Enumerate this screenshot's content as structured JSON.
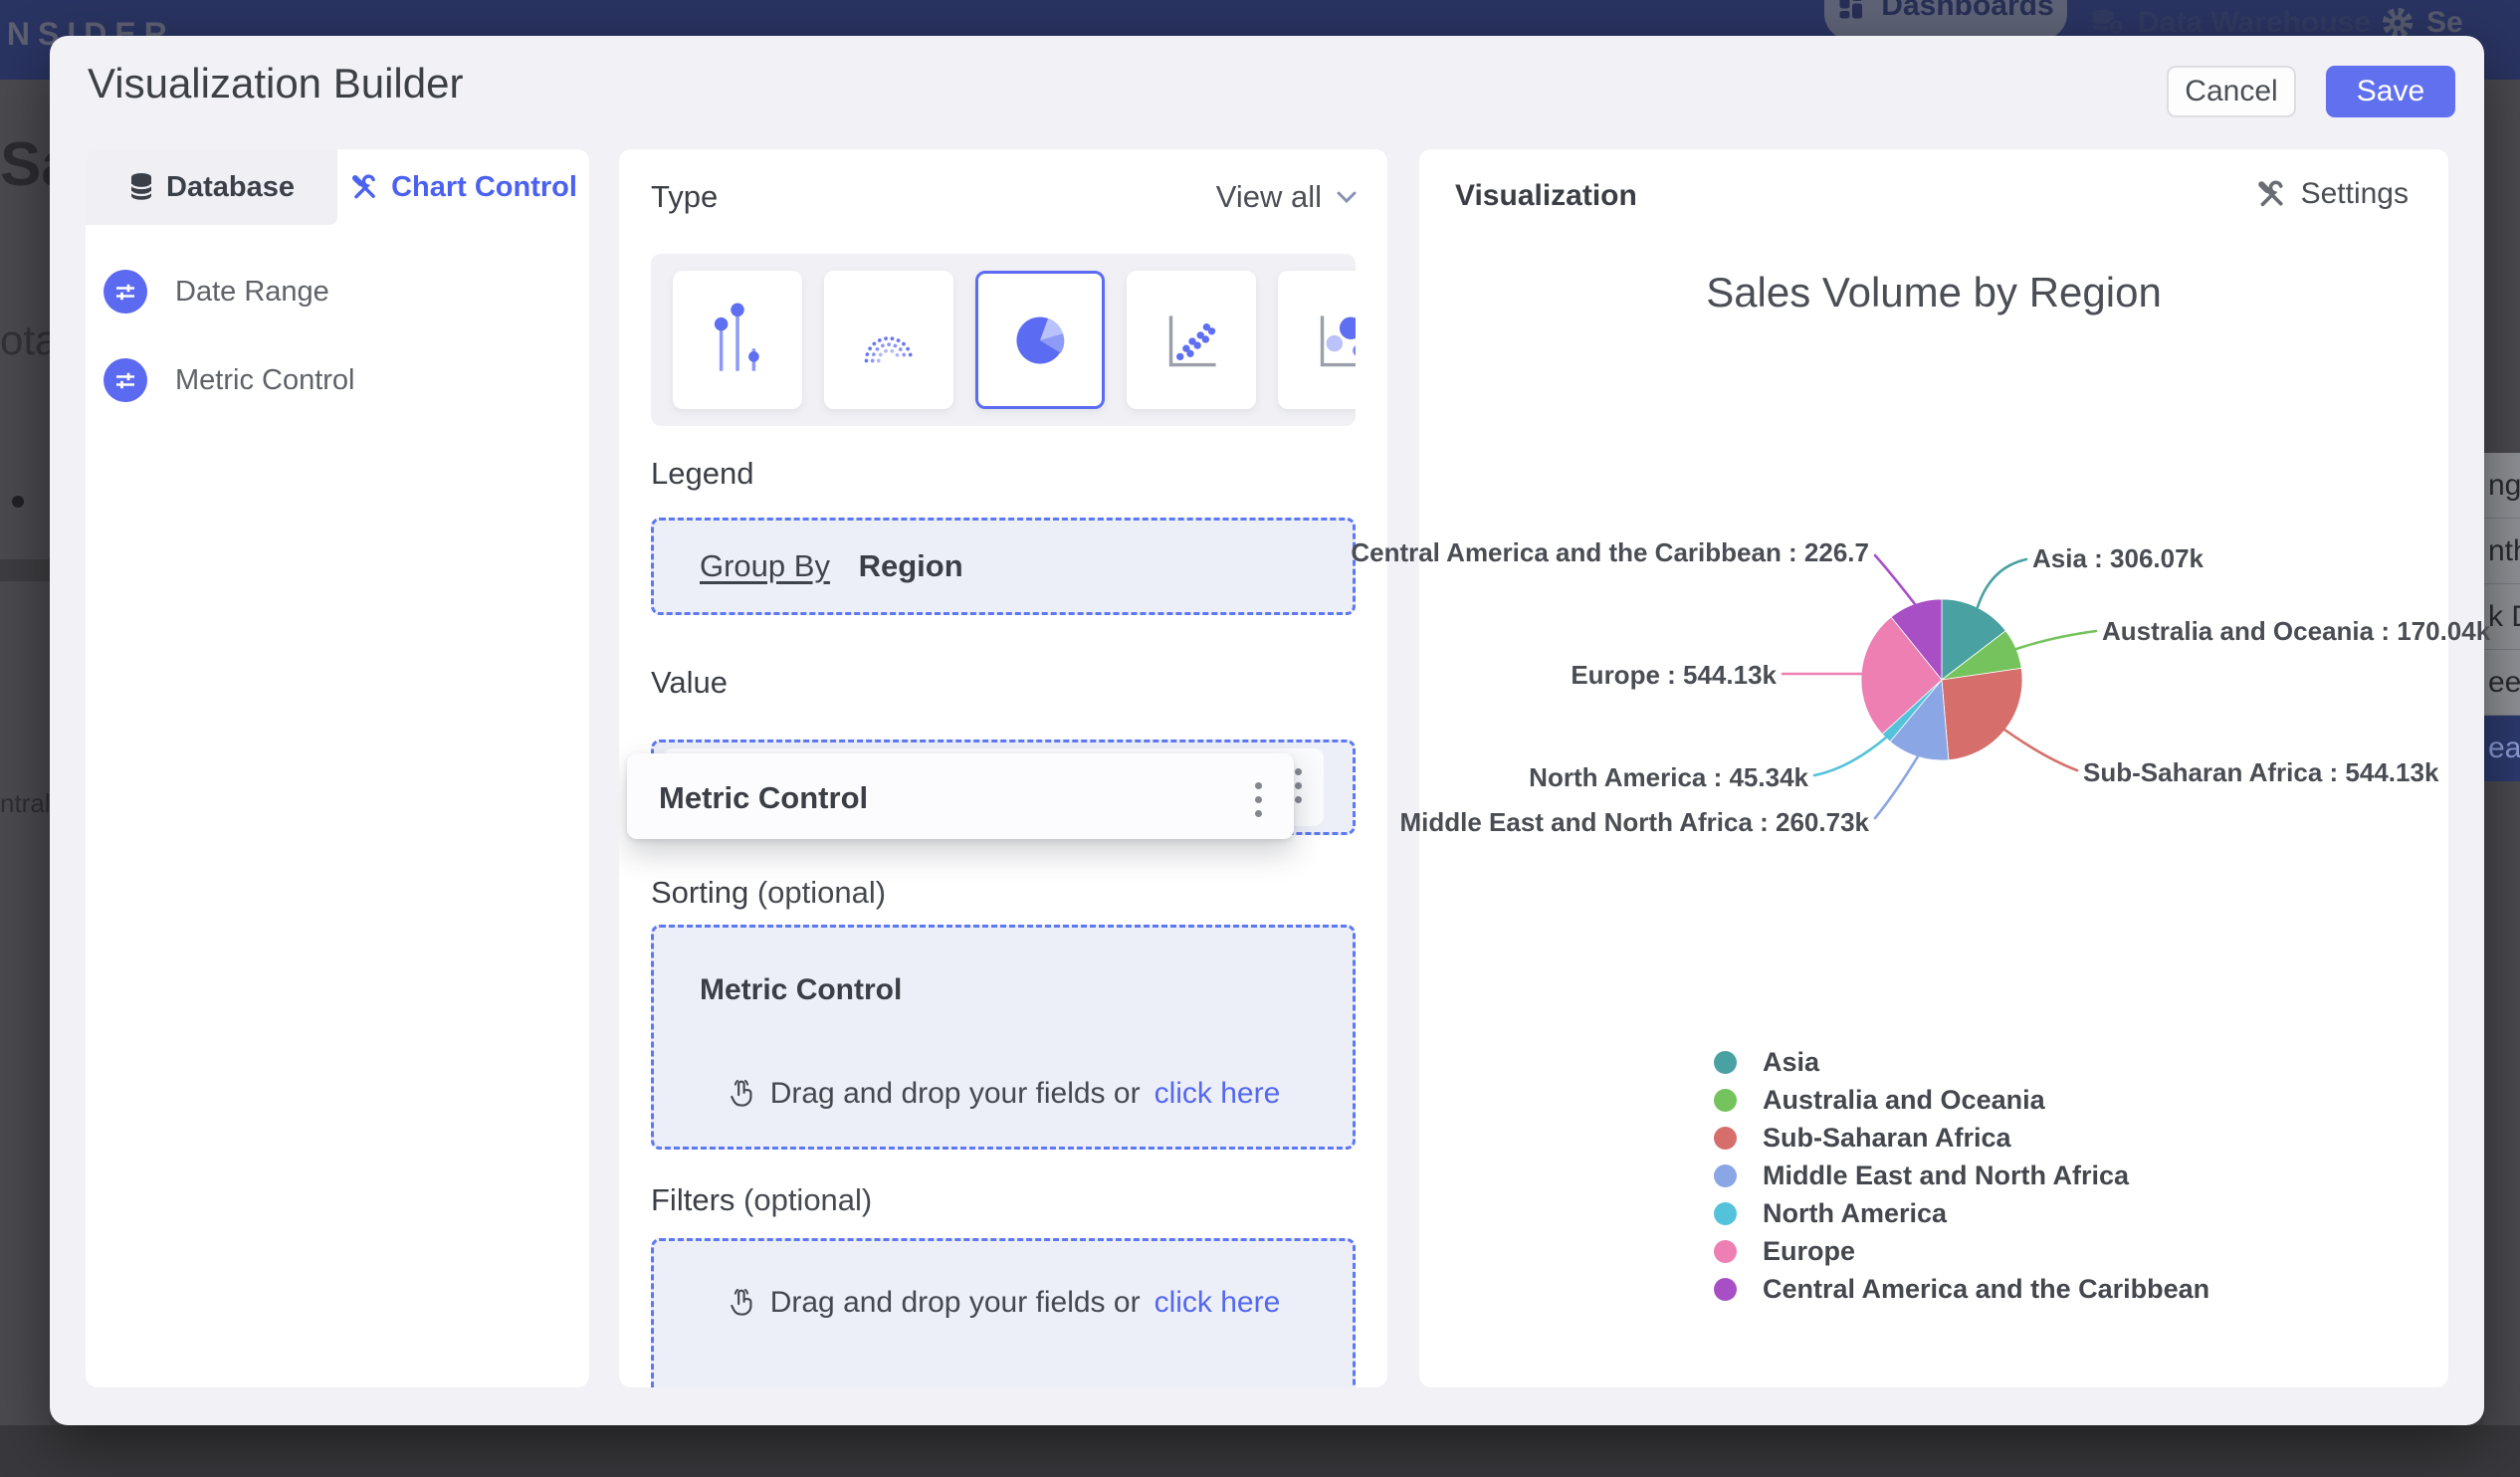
{
  "navbar": {
    "brand": "INSIDER",
    "dashboards": "Dashboards",
    "data_warehouse": "Data Warehouse",
    "settings_partial": "Se"
  },
  "background": {
    "left_fragments": [
      "Sal",
      "ota",
      "ntral"
    ],
    "menu_fragments": [
      "nge",
      "nth",
      "k D",
      "eek",
      "ear"
    ]
  },
  "modal": {
    "title": "Visualization Builder",
    "cancel_label": "Cancel",
    "save_label": "Save",
    "tabs": {
      "database": "Database",
      "chart_control": "Chart Control"
    },
    "sidebar_items": [
      {
        "label": "Date Range"
      },
      {
        "label": "Metric Control"
      }
    ],
    "builder": {
      "type_label": "Type",
      "view_all_label": "View all",
      "chart_types": [
        "lollipop",
        "arc",
        "pie",
        "scatter",
        "bubble"
      ],
      "selected_type": "pie",
      "legend_label": "Legend",
      "group_by_label": "Group By",
      "group_by_value": "Region",
      "value_label": "Value",
      "value_chip": "Metric Control",
      "sorting_label": "Sorting",
      "optional_suffix": "(optional)",
      "sorting_chip": "Metric Control",
      "filters_label": "Filters",
      "drop_text": "Drag and drop your fields or",
      "drop_link": "click here"
    },
    "visualization": {
      "panel_label": "Visualization",
      "settings_label": "Settings"
    }
  },
  "colors": {
    "accent": "#6170ee",
    "dashed_border": "#5d78f3",
    "link": "#5468f0",
    "navbar": "#2a3462"
  },
  "chart_data": {
    "type": "pie",
    "title": "Sales Volume by Region",
    "unit": "k",
    "categories": [
      "Asia",
      "Australia and Oceania",
      "Sub-Saharan Africa",
      "Middle East and North Africa",
      "North America",
      "Europe",
      "Central America and the Caribbean"
    ],
    "values": [
      306.07,
      170.04,
      544.13,
      260.73,
      45.34,
      544.13,
      226.7
    ],
    "labels": [
      "Asia : 306.07k",
      "Australia and Oceania : 170.04k",
      "Sub-Saharan Africa : 544.13k",
      "Middle East and North Africa : 260.73k",
      "North America : 45.34k",
      "Europe : 544.13k",
      "Central America and the Caribbean : 226.7"
    ],
    "colors": [
      "#4aa1a2",
      "#74c35c",
      "#d66f6b",
      "#8aa6e4",
      "#54c2db",
      "#ed7fb2",
      "#a94fc6"
    ],
    "legend_position": "bottom-left",
    "start_angle_deg": 0,
    "direction": "clockwise"
  }
}
